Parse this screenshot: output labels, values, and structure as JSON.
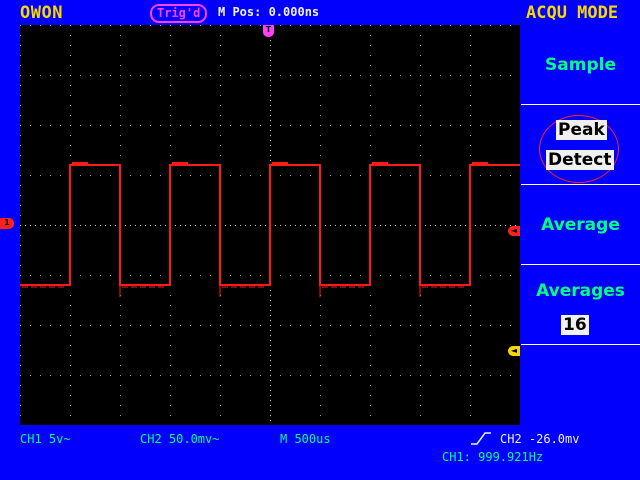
{
  "header": {
    "brand": "OWON",
    "trigger_status": "Trig'd",
    "m_pos": "M Pos: 0.000ns",
    "menu_title": "ACQU MODE"
  },
  "menu": {
    "items": [
      {
        "label": "Sample"
      },
      {
        "label_line1": "Peak",
        "label_line2": "Detect",
        "selected": true
      },
      {
        "label": "Average"
      },
      {
        "label": "Averages",
        "value": "16"
      }
    ]
  },
  "markers": {
    "trigger_top": "T",
    "ch1_left": "1",
    "trigger_level_right": "◄",
    "ch2_right": "◄"
  },
  "status": {
    "ch1_scale": "CH1 5v~",
    "ch2_scale": "CH2 50.0mv~",
    "timebase": "M 500us",
    "trigger_source_level": "CH2 -26.0mv",
    "frequency": "CH1: 999.921Hz"
  },
  "colors": {
    "background": "#0000fc",
    "trace": "#ff1a1a",
    "accent_yellow": "#f8d800",
    "menu_text": "#00ff80",
    "trigger_magenta": "#ff40ff"
  },
  "waveform": {
    "type": "square",
    "cycles_visible": 5,
    "high_divisions": 1.2,
    "low_divisions": -1.2,
    "duty": 0.5
  }
}
